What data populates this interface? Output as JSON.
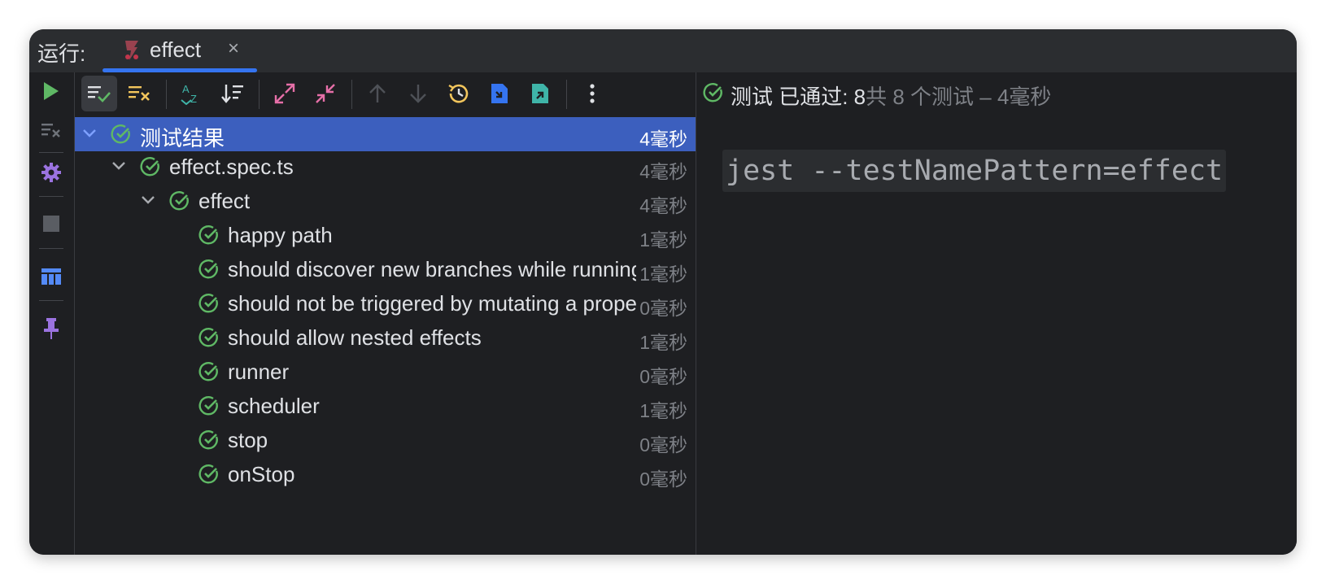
{
  "titlebar": {
    "run_label": "运行:",
    "tab": {
      "label": "effect",
      "close": "×",
      "icon": "jest-icon"
    }
  },
  "status": {
    "passed_text": "测试 已通过: 8",
    "rest_text": "共 8 个测试 – 4毫秒"
  },
  "console": {
    "command": "jest --testNamePattern=effect"
  },
  "tree": {
    "root": {
      "label": "测试结果",
      "time": "4毫秒"
    },
    "file": {
      "label": "effect.spec.ts",
      "time": "4毫秒"
    },
    "suite": {
      "label": "effect",
      "time": "4毫秒"
    },
    "tests": [
      {
        "label": "happy path",
        "time": "1毫秒"
      },
      {
        "label": "should discover new branches while running automatically",
        "time": "1毫秒"
      },
      {
        "label": "should not be triggered by mutating a property, which is used in an inactive branch",
        "time": "0毫秒"
      },
      {
        "label": "should allow nested effects",
        "time": "1毫秒"
      },
      {
        "label": "runner",
        "time": "0毫秒"
      },
      {
        "label": "scheduler",
        "time": "1毫秒"
      },
      {
        "label": "stop",
        "time": "0毫秒"
      },
      {
        "label": "onStop",
        "time": "0毫秒"
      }
    ]
  },
  "colors": {
    "accent": "#3574f0",
    "selection": "#3c5fbe",
    "pass_green": "#5fb865",
    "settings_purple": "#9b73e0"
  }
}
